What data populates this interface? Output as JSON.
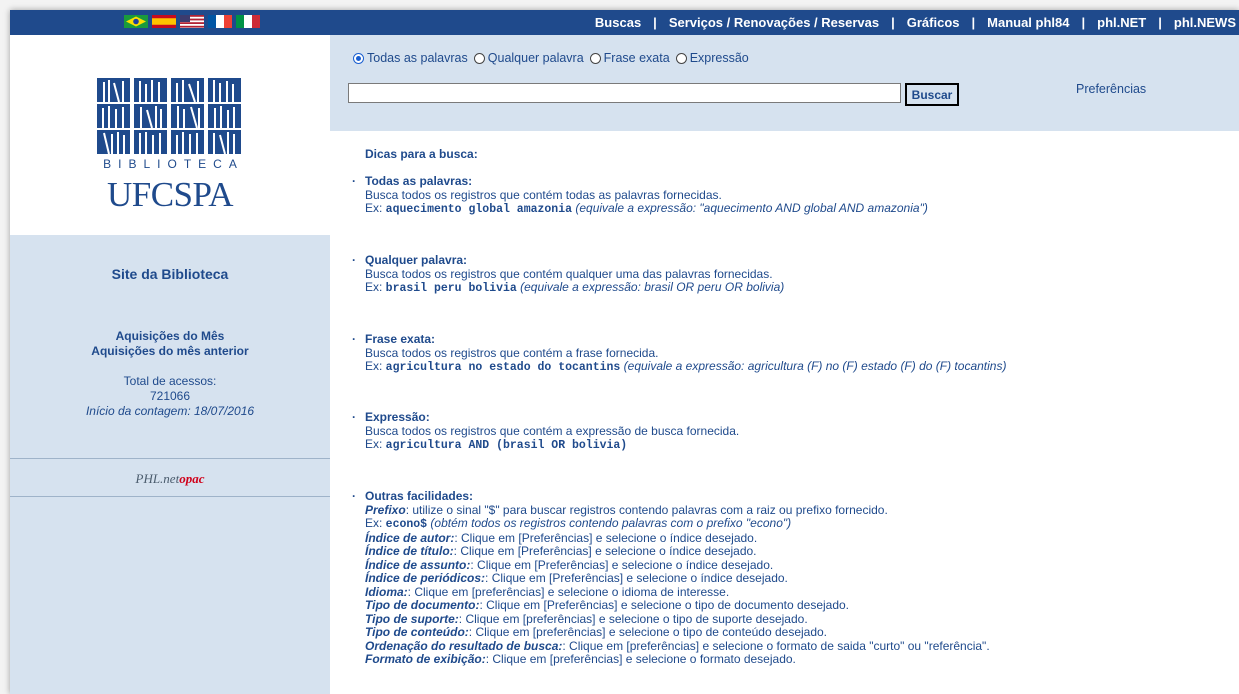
{
  "nav": {
    "items": [
      "Buscas",
      "Serviços / Renovações / Reservas",
      "Gráficos",
      "Manual phl84",
      "phl.NET",
      "phl.NEWS"
    ]
  },
  "flags": [
    "brazil-flag-icon",
    "spain-flag-icon",
    "usa-flag-icon",
    "france-flag-icon",
    "italy-flag-icon"
  ],
  "logo": {
    "line1": "BIBLIOTECA",
    "line2": "UFCSPA"
  },
  "sidebar": {
    "site_link": "Site da Biblioteca",
    "aquisicoes_mes": "Aquisições do Mês",
    "aquisicoes_anterior": "Aquisições do mês anterior",
    "total_label": "Total de acessos:",
    "total_value": "721066",
    "contagem": "Início da contagem: 18/07/2016",
    "phl_logo": {
      "phl": "PHL.net",
      "opac": "opac"
    }
  },
  "search": {
    "options": [
      "Todas as palavras",
      "Qualquer palavra",
      "Frase exata",
      "Expressão"
    ],
    "selected": "Todas as palavras",
    "input_value": "",
    "button": "Buscar",
    "preferences": "Preferências"
  },
  "tips": {
    "title": "Dicas para a busca:",
    "todas": {
      "heading": "Todas as palavras:",
      "desc": "Busca todos os registros que contém todas as palavras fornecidas.",
      "ex_label": "Ex: ",
      "ex_code": "aquecimento global amazonia",
      "ex_note": " (equivale a expressão: \"aquecimento AND global AND amazonia\")"
    },
    "qualquer": {
      "heading": "Qualquer palavra:",
      "desc": "Busca todos os registros que contém qualquer uma das palavras fornecidas.",
      "ex_label": "Ex: ",
      "ex_code": "brasil peru bolivia",
      "ex_note": " (equivale a expressão: brasil OR peru OR bolivia)"
    },
    "frase": {
      "heading": "Frase exata:",
      "desc": "Busca todos os registros que contém a frase fornecida.",
      "ex_label": "Ex: ",
      "ex_code": "agricultura no estado do tocantins",
      "ex_note": " (equivale a expressão: agricultura (F) no (F) estado (F) do (F) tocantins)"
    },
    "expressao": {
      "heading": "Expressão:",
      "desc": "Busca todos os registros que contém a expressão de busca fornecida.",
      "ex_label": "Ex: ",
      "ex_code": "agricultura AND (brasil OR bolivia)"
    },
    "outras": {
      "heading": "Outras facilidades:",
      "prefixo_label": "Prefixo",
      "prefixo_text": ": utilize o sinal \"$\" para buscar registros contendo palavras com a raiz ou prefixo fornecido.",
      "ex_label": "Ex: ",
      "ex_code": "econo$",
      "ex_note": " (obtém todos os registros contendo palavras com o prefixo \"econo\")",
      "items": [
        {
          "label": "Índice de autor:",
          "text": ": Clique em [Preferências] e selecione o índice desejado."
        },
        {
          "label": "Índice de título:",
          "text": ": Clique em [Preferências] e selecione o índice desejado."
        },
        {
          "label": "Índice de assunto:",
          "text": ": Clique em [Preferências] e selecione o índice desejado."
        },
        {
          "label": "Índice de periódicos:",
          "text": ": Clique em [Preferências] e selecione o índice desejado."
        },
        {
          "label": "Idioma:",
          "text": ": Clique em [preferências] e selecione o idioma de interesse."
        },
        {
          "label": "Tipo de documento:",
          "text": ": Clique em [Preferências] e selecione o tipo de documento desejado."
        },
        {
          "label": "Tipo de suporte:",
          "text": ": Clique em [preferências] e selecione o tipo de suporte desejado."
        },
        {
          "label": "Tipo de conteúdo:",
          "text": ": Clique em [preferências] e selecione o tipo de conteúdo desejado."
        },
        {
          "label": "Ordenação do resultado de busca:",
          "text": ": Clique em [preferências] e selecione o formato de saida \"curto\" ou \"referência\"."
        },
        {
          "label": "Formato de exibição:",
          "text": ": Clique em [preferências] e selecione o formato desejado."
        }
      ]
    }
  },
  "colors": {
    "nav_bg": "#1f4a8c",
    "panel_bg": "#d6e2ef",
    "text": "#1f4a8c",
    "accent_red": "#d0021b"
  }
}
